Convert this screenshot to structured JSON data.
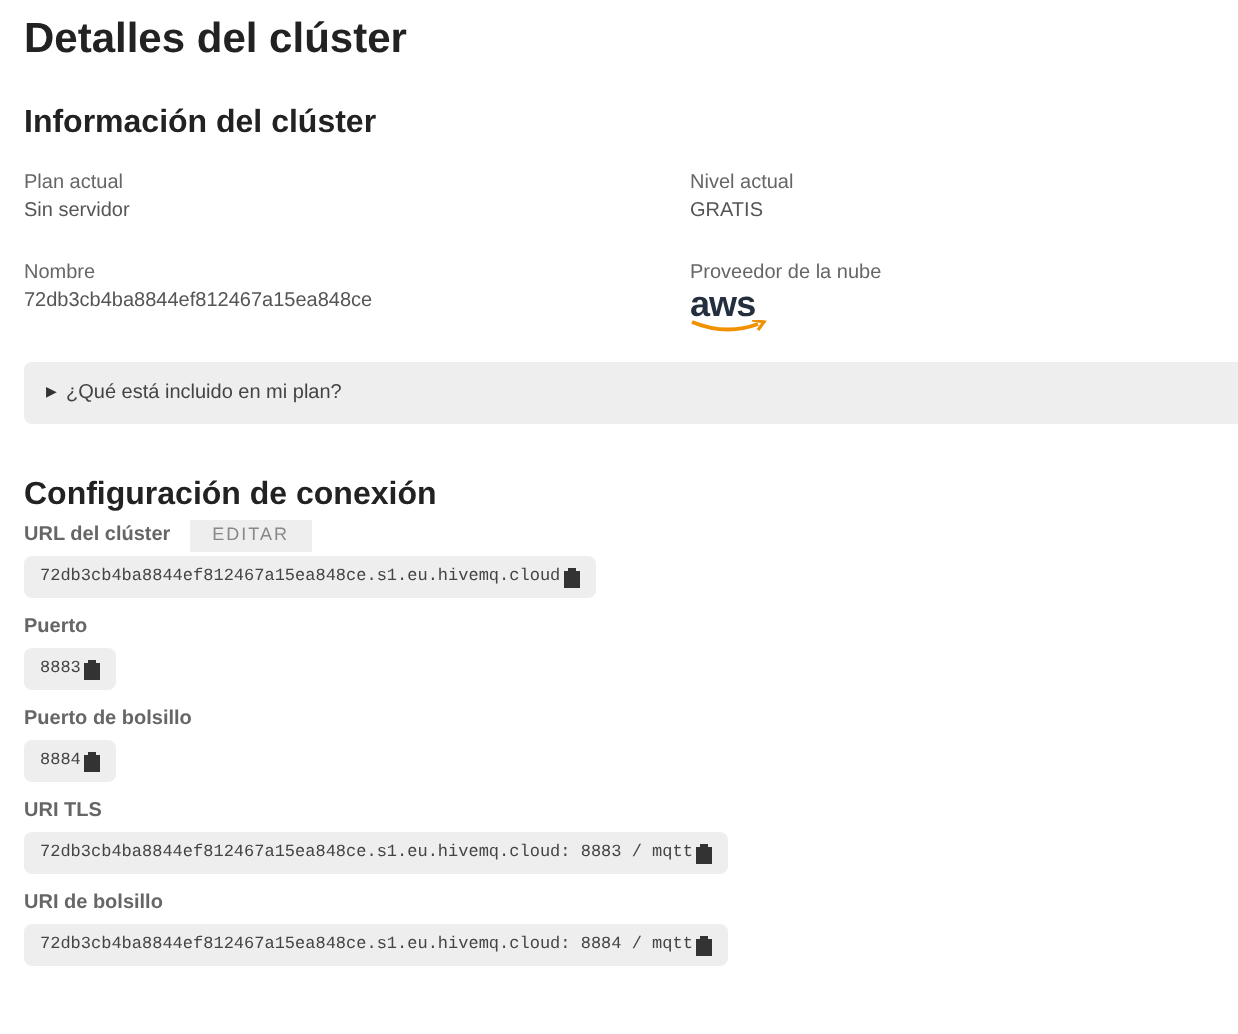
{
  "title": "Detalles del clúster",
  "info": {
    "heading": "Información del clúster",
    "fields": [
      {
        "kind": "text",
        "label": "Plan actual",
        "value": "Sin servidor"
      },
      {
        "kind": "text",
        "label": "Nivel actual",
        "value": "GRATIS"
      },
      {
        "kind": "text",
        "label": "Nombre",
        "value": "72db3cb4ba8844ef812467a15ea848ce"
      },
      {
        "kind": "logo",
        "label": "Proveedor de la nube",
        "value": "aws"
      }
    ]
  },
  "disclosure": {
    "label": "¿Qué está incluido en mi plan?",
    "marker": "▶",
    "expanded": false
  },
  "connection": {
    "heading": "Configuración de conexión",
    "fields": [
      {
        "label": "URL del clúster",
        "action": "EDITAR",
        "value": "72db3cb4ba8844ef812467a15ea848ce.s1.eu.hivemq.cloud"
      },
      {
        "label": "Puerto",
        "value": "8883"
      },
      {
        "label": "Puerto de bolsillo",
        "value": "8884"
      },
      {
        "label": "URI TLS",
        "value": "72db3cb4ba8844ef812467a15ea848ce.s1.eu.hivemq.cloud: 8883 / mqtt"
      },
      {
        "label": "URI de bolsillo",
        "value": "72db3cb4ba8844ef812467a15ea848ce.s1.eu.hivemq.cloud: 8884 / mqtt"
      }
    ]
  }
}
